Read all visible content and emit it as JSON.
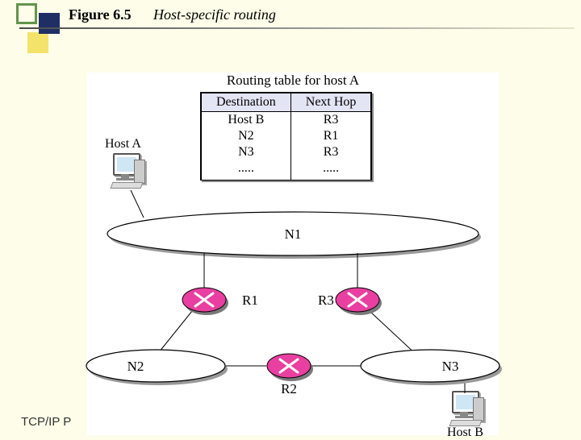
{
  "header": {
    "figure_label": "Figure 6.5",
    "figure_title": "Host-specific routing"
  },
  "routing_table": {
    "caption": "Routing table for host A",
    "columns": {
      "dest": "Destination",
      "next": "Next Hop"
    },
    "rows": [
      {
        "dest": "Host B",
        "next": "R3"
      },
      {
        "dest": "N2",
        "next": "R1"
      },
      {
        "dest": "N3",
        "next": "R3"
      },
      {
        "dest": ".....",
        "next": "....."
      }
    ]
  },
  "hosts": {
    "a_label": "Host A",
    "b_label": "Host B"
  },
  "networks": {
    "n1": "N1",
    "n2": "N2",
    "n3": "N3"
  },
  "routers": {
    "r1": "R1",
    "r2": "R2",
    "r3": "R3"
  },
  "footer": "TCP/IP P"
}
